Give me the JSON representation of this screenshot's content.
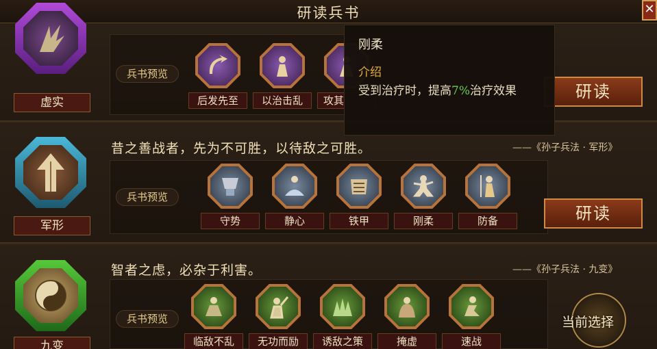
{
  "window": {
    "title": "研读兵书",
    "close_symbol": "✕"
  },
  "colors": {
    "accent_gold": "#e2ad36",
    "highlight_green": "#6ad04a",
    "button_red": "#8a3a18"
  },
  "sections": [
    {
      "emblem_label": "虚实",
      "emblem_icon": "claw-icon",
      "preview_label": "兵书预览",
      "skills": [
        {
          "name": "后发先至",
          "icon": "arrow-swirl-icon"
        },
        {
          "name": "以治击乱",
          "icon": "warrior-icon"
        },
        {
          "name": "攻其",
          "icon": "fighter-icon"
        }
      ],
      "action_label": "研读"
    },
    {
      "quote": "昔之善战者，先为不可胜，以待敌之可胜。",
      "source": "——《孙子兵法 · 军形》",
      "emblem_label": "军形",
      "emblem_icon": "arrow-up-icon",
      "preview_label": "兵书预览",
      "skills": [
        {
          "name": "守势",
          "icon": "shield-cup-icon"
        },
        {
          "name": "静心",
          "icon": "meditate-icon"
        },
        {
          "name": "铁甲",
          "icon": "armor-icon"
        },
        {
          "name": "刚柔",
          "icon": "martial-icon"
        },
        {
          "name": "防备",
          "icon": "guard-icon"
        }
      ],
      "action_label": "研读"
    },
    {
      "quote": "智者之虑，必杂于利害。",
      "source": "——《孙子兵法 · 九变》",
      "emblem_label": "九变",
      "emblem_icon": "yin-yang-icon",
      "preview_label": "兵书预览",
      "skills": [
        {
          "name": "临敌不乱",
          "icon": "calm-icon"
        },
        {
          "name": "无功而励",
          "icon": "encourage-icon"
        },
        {
          "name": "诱敌之策",
          "icon": "lure-icon"
        },
        {
          "name": "掩虚",
          "icon": "cloak-icon"
        },
        {
          "name": "速战",
          "icon": "charge-icon"
        }
      ],
      "current_label": "当前选择"
    }
  ],
  "tooltip": {
    "name": "刚柔",
    "heading": "介绍",
    "desc_before": "受到治疗时，提高",
    "desc_value": "7%",
    "desc_after": "治疗效果"
  }
}
